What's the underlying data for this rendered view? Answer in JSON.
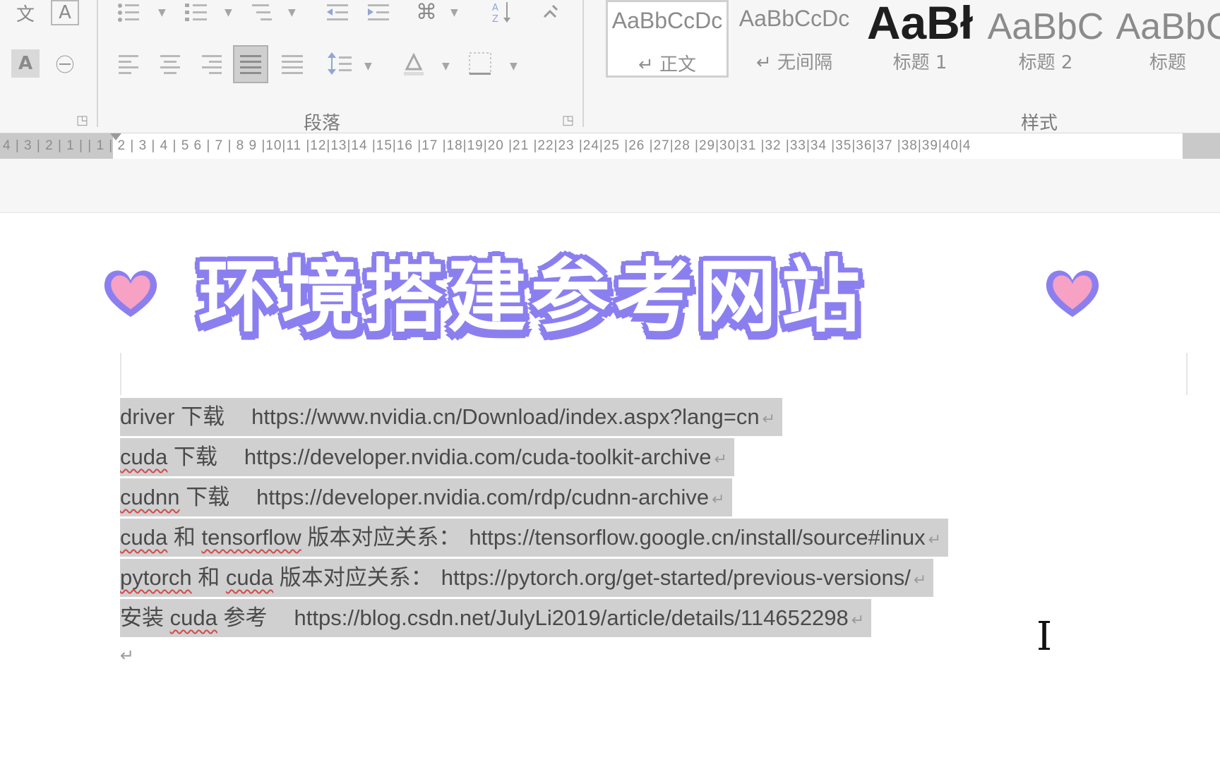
{
  "ribbon": {
    "paragraph_group_label": "段落",
    "styles_group_label": "样式",
    "font_icons": [
      "文",
      "A",
      "A",
      "㊀"
    ],
    "styles": [
      {
        "sample": "AaBbCcDc",
        "name": "↵ 正文"
      },
      {
        "sample": "AaBbCcDc",
        "name": "↵ 无间隔"
      },
      {
        "sample": "AaBł",
        "name": "标题 1"
      },
      {
        "sample": "AaBbC",
        "name": "标题 2"
      },
      {
        "sample": "AaBbC",
        "name": "标题"
      }
    ]
  },
  "ruler": {
    "text": "4 | 3 | 2 | 1 |   | 1 | 2 | 3 | 4 | 5   6 | 7 | 8   9 |10|11 |12|13|14 |15|16 |17 |18|19|20 |21 |22|23 |24|25 |26 |27|28 |29|30|31 |32 |33|34 |35|36|37 |38|39|40|4"
  },
  "document": {
    "banner_title": "环境搭建参考网站",
    "lines": [
      {
        "prefix": "driver",
        "label": " 下载",
        "url": "https://www.nvidia.cn/Download/index.aspx?lang=cn"
      },
      {
        "prefix": "cuda",
        "label": " 下载",
        "url": "https://developer.nvidia.com/cuda-toolkit-archive"
      },
      {
        "prefix": "cudnn",
        "label": " 下载",
        "url": "https://developer.nvidia.com/rdp/cudnn-archive"
      },
      {
        "prefix": "cuda",
        "label": " 和 ",
        "extra": "tensorflow",
        "label2": " 版本对应关系：",
        "url": "https://tensorflow.google.cn/install/source#linux"
      },
      {
        "prefix": "pytorch",
        "label": " 和 ",
        "extra": "cuda",
        "label2": " 版本对应关系：",
        "url": "https://pytorch.org/get-started/previous-versions/"
      },
      {
        "prefix": "安装 ",
        "extra0": "cuda",
        "label": " 参考",
        "url": "https://blog.csdn.net/JulyLi2019/article/details/114652298"
      }
    ],
    "paragraph_mark": "↵",
    "cursor_glyph": "I"
  },
  "colors": {
    "banner_outline": "#8b7ff0",
    "heart_fill": "#f7a1c4",
    "selection": "#d0d0d0"
  }
}
